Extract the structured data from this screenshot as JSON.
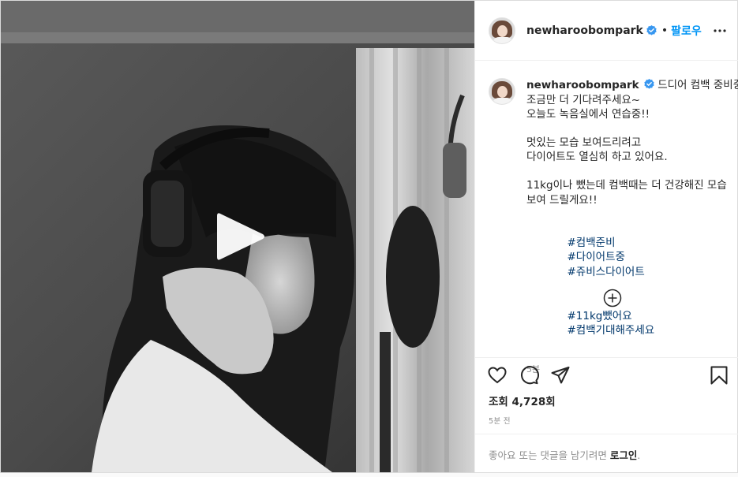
{
  "post": {
    "username": "newharoobompark",
    "separator": "•",
    "follow_label": "팔로우",
    "caption": {
      "first_line": "드디어 컴백 중비중!",
      "lines": [
        "조금만 더 기다려주세요~",
        "오늘도 녹음실에서 연습중!!",
        "",
        "멋있는 모습 보여드리려고",
        "다이어트도 열심히 하고 있어요.",
        "",
        "11kg이나 뺐는데 컴백때는 더 건강해진 모습",
        "보여 드릴게요!!",
        ""
      ],
      "hashtags_line1": [
        "#컴백준비",
        "#다이어트중",
        "#쥬비스다이어트"
      ],
      "hashtags_line2": [
        "#11kg뺐어요",
        "#컴백기대해주세요"
      ],
      "time": "5분"
    },
    "views_label": "조회 4,728회",
    "timestamp": "5분 전",
    "login_prompt": "좋아요 또는 댓글을 남기려면 ",
    "login_link": "로그인",
    "login_suffix": "."
  },
  "icons": {
    "header": [
      "verified-icon",
      "more-icon"
    ],
    "media": [
      "play-icon"
    ],
    "comments": [
      "add-circle-icon"
    ],
    "actions": [
      "heart-icon",
      "comment-icon",
      "share-icon",
      "bookmark-icon"
    ]
  },
  "colors": {
    "follow": "#0095f6",
    "verified": "#3897f0",
    "hashtag": "#00376b",
    "muted": "#8e8e8e",
    "border": "#dbdbdb"
  }
}
